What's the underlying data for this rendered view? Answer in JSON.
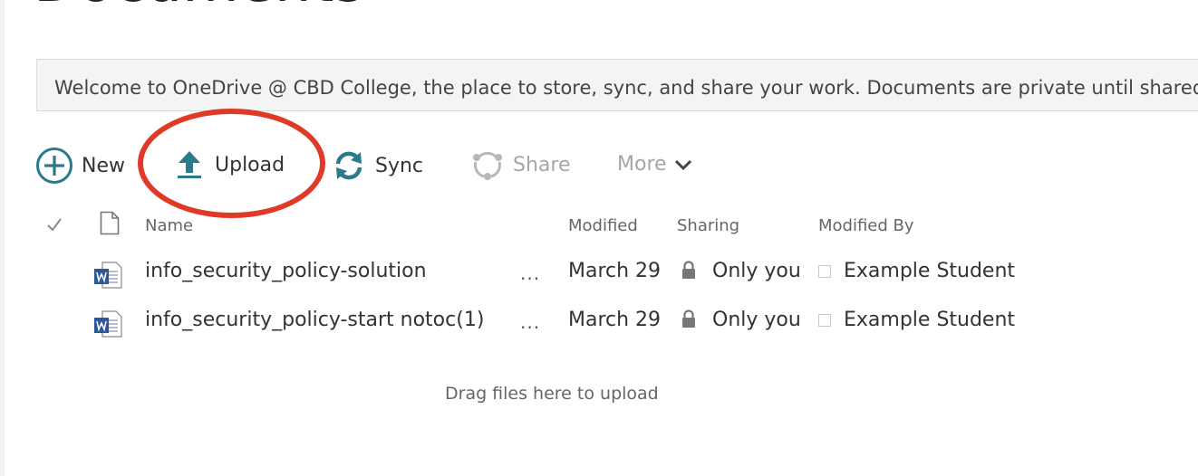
{
  "page": {
    "title": "Documents"
  },
  "banner": {
    "text": "Welcome to OneDrive @ CBD College, the place to store, sync, and share your work. Documents are private until shared."
  },
  "toolbar": {
    "new_label": "New",
    "upload_label": "Upload",
    "sync_label": "Sync",
    "share_label": "Share",
    "more_label": "More"
  },
  "columns": {
    "name": "Name",
    "modified": "Modified",
    "sharing": "Sharing",
    "modified_by": "Modified By"
  },
  "files": [
    {
      "name": "info_security_policy-solution",
      "modified": "March 29",
      "sharing": "Only you",
      "modified_by": "Example Student",
      "icon": "word-doc-icon"
    },
    {
      "name": "info_security_policy-start notoc(1)",
      "modified": "March 29",
      "sharing": "Only you",
      "modified_by": "Example Student",
      "icon": "word-doc-icon"
    }
  ],
  "list": {
    "ellipsis": "..."
  },
  "drop_zone": {
    "text": "Drag files here to upload"
  },
  "colors": {
    "accent": "#2b7a8c",
    "highlight": "#e03a26",
    "word_blue": "#2b579a"
  }
}
